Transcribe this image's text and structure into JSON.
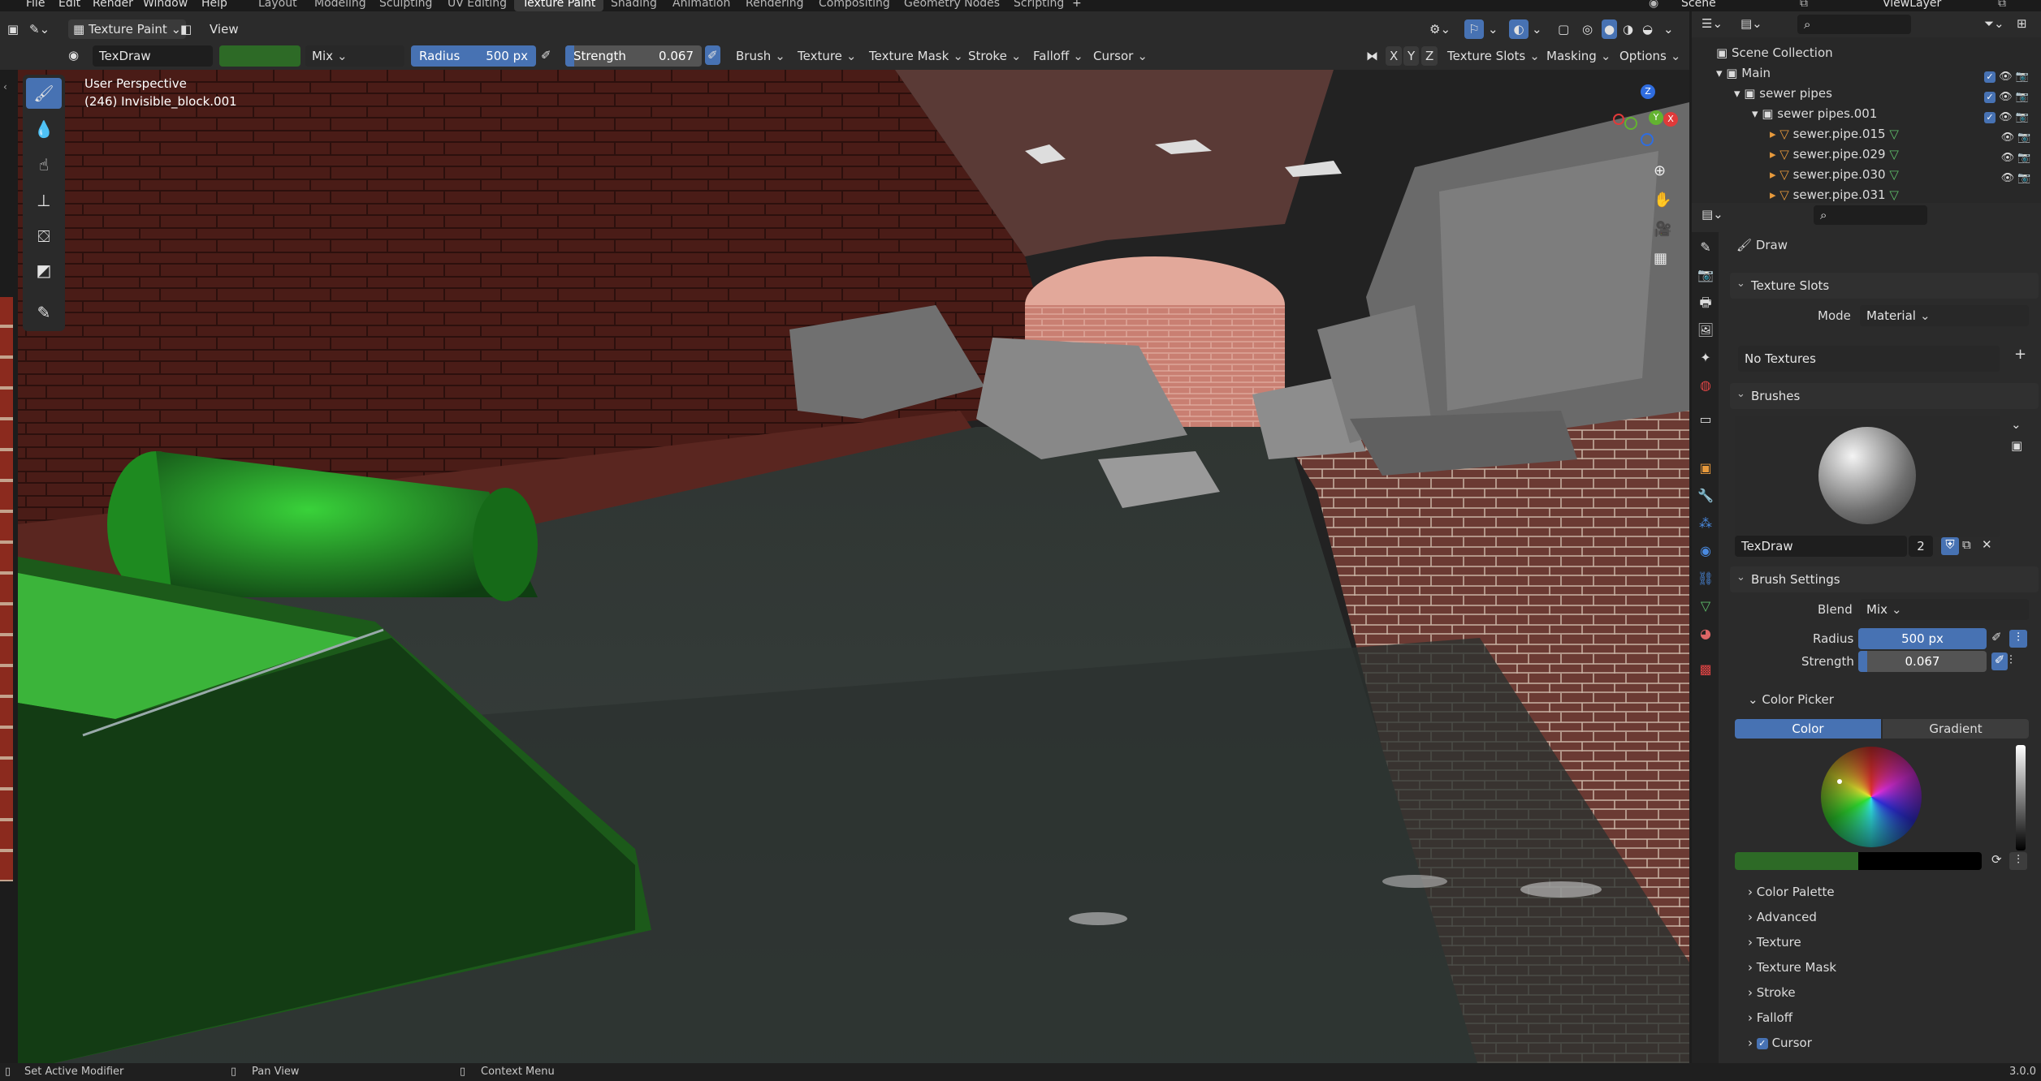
{
  "menu": {
    "items": [
      "File",
      "Edit",
      "Render",
      "Window",
      "Help"
    ]
  },
  "workspaces": {
    "tabs": [
      "Layout",
      "Modeling",
      "Sculpting",
      "UV Editing",
      "Texture Paint",
      "Shading",
      "Animation",
      "Rendering",
      "Compositing",
      "Geometry Nodes",
      "Scripting"
    ],
    "active": "Texture Paint"
  },
  "scene": {
    "name": "Scene",
    "view_layer": "ViewLayer"
  },
  "header": {
    "mode": "Texture Paint",
    "view_label": "View"
  },
  "tool_settings": {
    "brush_name": "TexDraw",
    "color": "#2d6a26",
    "blend": "Mix",
    "radius_label": "Radius",
    "radius_value": "500 px",
    "strength_label": "Strength",
    "strength_value": "0.067",
    "menus": [
      "Brush",
      "Texture",
      "Texture Mask",
      "Stroke",
      "Falloff",
      "Cursor"
    ],
    "axes": [
      "X",
      "Y",
      "Z"
    ],
    "right_menus": [
      "Texture Slots",
      "Masking",
      "Options"
    ]
  },
  "viewport": {
    "perspective": "User Perspective",
    "object": "(246) Invisible_block.001"
  },
  "gizmo": {
    "z": "Z",
    "x": "X",
    "y": "Y"
  },
  "outliner": {
    "search_placeholder": "",
    "items": [
      {
        "label": "Scene Collection",
        "level": 0
      },
      {
        "label": "Main",
        "level": 1
      },
      {
        "label": "sewer pipes",
        "level": 2
      },
      {
        "label": "sewer pipes.001",
        "level": 3
      },
      {
        "label": "sewer.pipe.015",
        "level": 4
      },
      {
        "label": "sewer.pipe.029",
        "level": 4
      },
      {
        "label": "sewer.pipe.030",
        "level": 4
      },
      {
        "label": "sewer.pipe.031",
        "level": 4
      }
    ]
  },
  "properties": {
    "tool_name": "Draw",
    "texture_slots": {
      "title": "Texture Slots",
      "mode_label": "Mode",
      "mode_value": "Material",
      "empty": "No Textures"
    },
    "brushes": {
      "title": "Brushes",
      "name": "TexDraw",
      "users": "2"
    },
    "brush_settings": {
      "title": "Brush Settings",
      "blend_label": "Blend",
      "blend_value": "Mix",
      "radius_label": "Radius",
      "radius_value": "500 px",
      "strength_label": "Strength",
      "strength_value": "0.067"
    },
    "color_picker": {
      "title": "Color Picker",
      "tab_color": "Color",
      "tab_gradient": "Gradient",
      "primary": "#2d6a26",
      "secondary": "#000000"
    },
    "collapsed_panels": [
      "Color Palette",
      "Advanced",
      "Texture",
      "Texture Mask",
      "Stroke",
      "Falloff",
      "Cursor"
    ]
  },
  "status": {
    "left": "Set Active Modifier",
    "middle": "Pan View",
    "right": "Context Menu",
    "version": "3.0.0"
  }
}
